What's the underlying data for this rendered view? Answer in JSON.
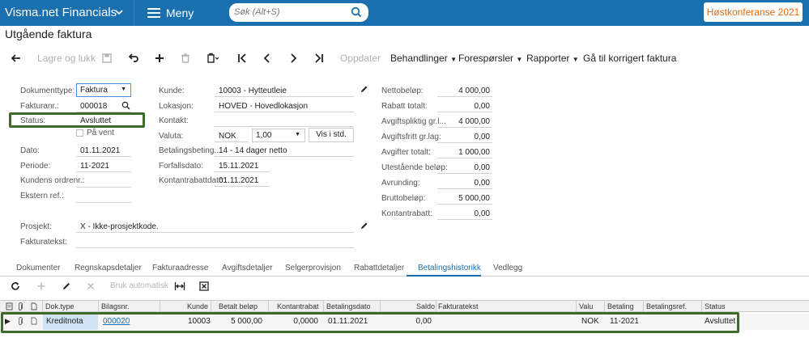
{
  "app": {
    "brand": "Visma.net Financials",
    "menu_label": "Meny",
    "search_placeholder": "Søk (Alt+S)",
    "promo_label": "Høstkonferanse 2021"
  },
  "page": {
    "title": "Utgående faktura"
  },
  "toolbar": {
    "save_close": "Lagre og lukk",
    "update": "Oppdater",
    "actions": "Behandlinger",
    "inquiries": "Forespørsler",
    "reports": "Rapporter",
    "goto_corrected": "Gå til korrigert faktura"
  },
  "form": {
    "doc_type_label": "Dokumenttype:",
    "doc_type_value": "Faktura",
    "invoice_no_label": "Fakturanr.:",
    "invoice_no_value": "000018",
    "status_label": "Status:",
    "status_value": "Avsluttet",
    "on_hold_label": "På vent",
    "date_label": "Dato:",
    "date_value": "01.11.2021",
    "period_label": "Periode:",
    "period_value": "11-2021",
    "customer_order_label": "Kundens ordrenr.:",
    "external_ref_label": "Ekstern ref.:",
    "customer_label": "Kunde:",
    "customer_value": "10003 - Hytteutleie",
    "location_label": "Lokasjon:",
    "location_value": "HOVED - Hovedlokasjon",
    "contact_label": "Kontakt:",
    "currency_label": "Valuta:",
    "currency_value": "NOK",
    "rate_value": "1,00",
    "view_std_label": "Vis i std.",
    "payment_terms_label": "Betalingsbeting...",
    "payment_terms_value": "14 - 14 dager netto",
    "due_date_label": "Forfallsdato:",
    "due_date_value": "15.11.2021",
    "cash_discount_date_label": "Kontantrabattdato:",
    "cash_discount_date_value": "01.11.2021",
    "project_label": "Prosjekt:",
    "project_value": "X - Ikke-prosjektkode.",
    "invoice_text_label": "Fakturatekst:"
  },
  "totals": [
    {
      "label": "Nettobeløp:",
      "value": "4 000,00"
    },
    {
      "label": "Rabatt totalt:",
      "value": "0,00"
    },
    {
      "label": "Avgiftspliktig gr.l...",
      "value": "4 000,00"
    },
    {
      "label": "Avgiftsfritt gr.lag:",
      "value": "0,00"
    },
    {
      "label": "Avgifter totalt:",
      "value": "1 000,00"
    },
    {
      "label": "Utestående beløp:",
      "value": "0,00"
    },
    {
      "label": "Avrunding:",
      "value": "0,00"
    },
    {
      "label": "Bruttobeløp:",
      "value": "5 000,00"
    },
    {
      "label": "Kontantrabatt:",
      "value": "0,00"
    }
  ],
  "tabs": [
    "Dokumenter",
    "Regnskapsdetaljer",
    "Fakturaadresse",
    "Avgiftsdetaljer",
    "Selgerprovisjon",
    "Rabattdetaljer",
    "Betalingshistorikk",
    "Vedlegg"
  ],
  "grid_toolbar": {
    "auto_apply": "Bruk automatisk"
  },
  "grid": {
    "headers": {
      "doc_type": "Dok.type",
      "ref_no": "Bilagsnr.",
      "customer": "Kunde",
      "paid_amount": "Betalt beløp",
      "cash_discount": "Kontantrabat",
      "payment_date": "Betalingsdato",
      "balance": "Saldo",
      "invoice_text": "Fakturatekst",
      "currency": "Valu",
      "payment": "Betaling",
      "payment_ref": "Betalingsref.",
      "status": "Status"
    },
    "rows": [
      {
        "doc_type": "Kreditnota",
        "ref_no": "000020",
        "customer": "10003",
        "paid_amount": "5 000,00",
        "cash_discount": "0,0000",
        "payment_date": "01.11.2021",
        "balance": "0,00",
        "invoice_text": "",
        "currency": "NOK",
        "payment": "11-2021",
        "payment_ref": "",
        "status": "Avsluttet"
      }
    ]
  }
}
